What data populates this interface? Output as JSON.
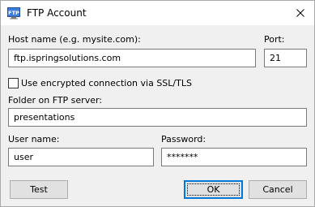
{
  "window": {
    "title": "FTP Account",
    "icon": "ftp-app-icon",
    "icon_text": "FTP",
    "close_icon": "close-icon"
  },
  "form": {
    "host_label": "Host name (e.g. mysite.com):",
    "host_value": "ftp.ispringsolutions.com",
    "port_label": "Port:",
    "port_value": "21",
    "ssl_label": "Use encrypted connection via SSL/TLS",
    "ssl_checked": false,
    "folder_label": "Folder on FTP server:",
    "folder_value": "presentations",
    "user_label": "User name:",
    "user_value": "user",
    "password_label": "Password:",
    "password_value": "*******"
  },
  "buttons": {
    "test": "Test",
    "ok": "OK",
    "cancel": "Cancel"
  },
  "colors": {
    "accent": "#0078d7",
    "dialog_bg": "#f0f0f0",
    "title_bg": "#ffffff",
    "field_border": "#7a7a7a"
  }
}
